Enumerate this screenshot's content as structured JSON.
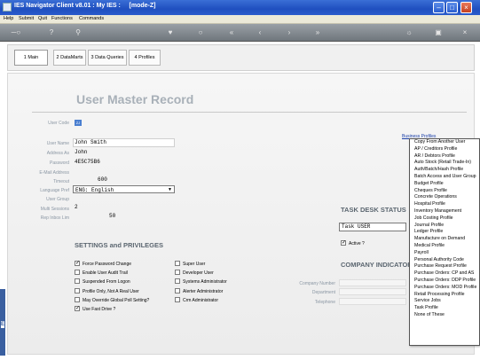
{
  "window": {
    "title": "IES Navigator Client v8.01 : My IES :     [mode-Z]",
    "min_label": "–",
    "max_label": "□",
    "close_label": "×"
  },
  "menu": {
    "items": [
      "Help",
      "Submit",
      "Quit",
      "Functions",
      "Commands"
    ]
  },
  "toolbar": {
    "icons": [
      "key-icon",
      "help-icon",
      "search-icon",
      "heart-icon",
      "circle-icon",
      "first-icon",
      "prev-icon",
      "next-icon",
      "last-icon",
      "brightness-icon",
      "lock-icon",
      "close-icon"
    ],
    "glyphs": [
      "─○",
      "?",
      "⚲",
      "♥",
      "○",
      "«",
      "‹",
      "›",
      "»",
      "☼",
      "▣",
      "×"
    ]
  },
  "tabs": [
    {
      "label": "1 Main"
    },
    {
      "label": "2 DataMarts"
    },
    {
      "label": "3 Data Queries"
    },
    {
      "label": "4 Profiles"
    }
  ],
  "page": {
    "title": "User Master Record"
  },
  "user_code": {
    "label": "User Code",
    "value": "ZJ"
  },
  "fields": [
    {
      "label": "User Name",
      "value": "John Smith"
    },
    {
      "label": "Address As",
      "value": "John"
    },
    {
      "label": "Password",
      "value": "4E5C75B6"
    },
    {
      "label": "E-Mail Address",
      "value": ""
    },
    {
      "label": "Timeout",
      "value": "600"
    }
  ],
  "language": {
    "label": "Language Pref",
    "value": "ENG: English",
    "arrow": "▼"
  },
  "user_group": {
    "label": "User Group",
    "value": ""
  },
  "multi_sessions": {
    "label": "Multi Sessions",
    "value": "2"
  },
  "max_inbox": {
    "label": "Rep Inbox Lim",
    "value": "50"
  },
  "settings": {
    "title": "SETTINGS and PRIVILEGES",
    "left": [
      {
        "label": "Force Password Change",
        "checked": true
      },
      {
        "label": "Enable User Audit Trail",
        "checked": false
      },
      {
        "label": "Suspended From Logon",
        "checked": false
      },
      {
        "label": "Profile Only, Not A Real User",
        "checked": false
      },
      {
        "label": "May Override Global Poll Setting?",
        "checked": false
      },
      {
        "label": "Use Fast Drive ?",
        "checked": true
      }
    ],
    "right": [
      {
        "label": "Super User",
        "checked": false
      },
      {
        "label": "Developer User",
        "checked": false
      },
      {
        "label": "Systems Administrator",
        "checked": false
      },
      {
        "label": "Alerter Administrator",
        "checked": false
      },
      {
        "label": "Crm Administrator",
        "checked": false
      }
    ]
  },
  "task_desk": {
    "title": "TASK DESK STATUS",
    "value": "Task USER",
    "active_label": "Active ?",
    "active_checked": true
  },
  "company": {
    "title": "COMPANY INDICATOR",
    "fields": [
      {
        "label": "Company Number"
      },
      {
        "label": "Department"
      },
      {
        "label": "Telephone"
      }
    ]
  },
  "business_profiles": {
    "link": "Business Profiles",
    "items": [
      "Copy From Another User",
      "AP / Creditors Profile",
      "AR / Debtors Profile",
      "Auto Stock (Retail Trade-In)",
      "Auth/Batch/Hash Profile",
      "Batch Access and User Group",
      "Budget Profile",
      "Cheques Profile",
      "Concrete Operations",
      "Hospital Profile",
      "Inventory Management",
      "Job Costing Profile",
      "Journal Profile",
      "Ledger Profile",
      "Manufacture on Demand",
      "Medical Profile",
      "Payroll",
      "Personal Authority Code",
      "Purchase Request Profile",
      "Purchase Orders: CP and AS",
      "Purchase Orders: DDP Profile",
      "Purchase Orders: MOD Profile",
      "Retail Processing Profile",
      "Service Jobs",
      "Task Profile",
      "None of These"
    ]
  },
  "check_glyph": "✓",
  "leftbar": {
    "mark": "E"
  }
}
